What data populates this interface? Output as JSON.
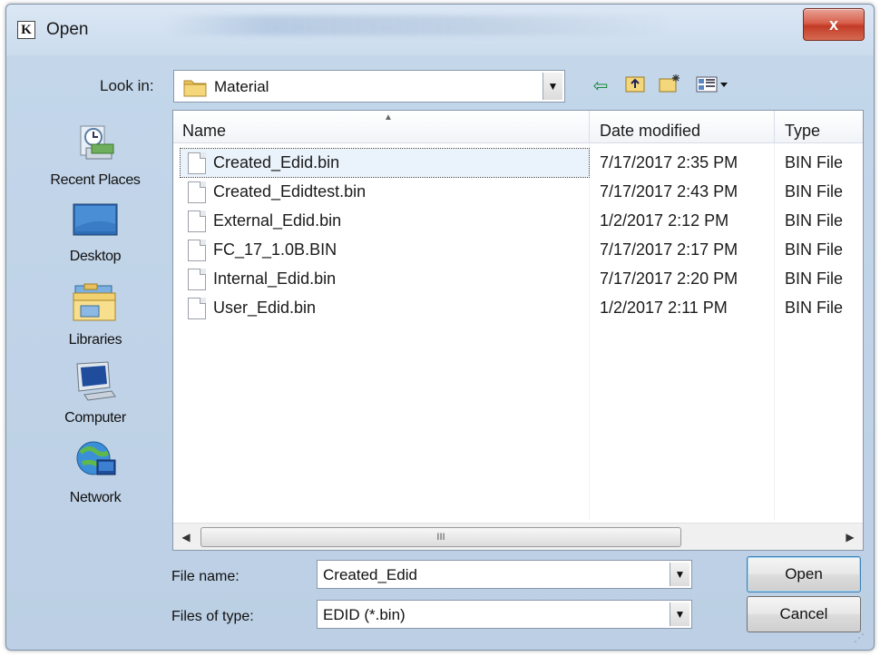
{
  "window": {
    "title": "Open",
    "app_icon_letter": "K",
    "close_symbol": "x"
  },
  "lookin": {
    "label": "Look in:",
    "value": "Material"
  },
  "toolbar": {
    "back_icon": "back-arrow-icon",
    "up_icon": "up-folder-icon",
    "new_folder_icon": "new-folder-icon",
    "view_icon": "view-menu-icon"
  },
  "places": [
    {
      "label": "Recent Places",
      "icon": "recent-places-icon"
    },
    {
      "label": "Desktop",
      "icon": "desktop-icon"
    },
    {
      "label": "Libraries",
      "icon": "libraries-icon"
    },
    {
      "label": "Computer",
      "icon": "computer-icon"
    },
    {
      "label": "Network",
      "icon": "network-icon"
    }
  ],
  "columns": {
    "name": "Name",
    "date": "Date modified",
    "type": "Type"
  },
  "files": [
    {
      "name": "Created_Edid.bin",
      "date": "7/17/2017 2:35 PM",
      "type": "BIN File",
      "selected": true
    },
    {
      "name": "Created_Edidtest.bin",
      "date": "7/17/2017 2:43 PM",
      "type": "BIN File"
    },
    {
      "name": "External_Edid.bin",
      "date": "1/2/2017 2:12 PM",
      "type": "BIN File"
    },
    {
      "name": "FC_17_1.0B.BIN",
      "date": "7/17/2017 2:17 PM",
      "type": "BIN File"
    },
    {
      "name": "Internal_Edid.bin",
      "date": "7/17/2017 2:20 PM",
      "type": "BIN File"
    },
    {
      "name": "User_Edid.bin",
      "date": "1/2/2017 2:11 PM",
      "type": "BIN File"
    }
  ],
  "scrollbar": {
    "grip": "III"
  },
  "filename": {
    "label": "File name:",
    "value": "Created_Edid"
  },
  "filetype": {
    "label": "Files of type:",
    "value": "EDID (*.bin)"
  },
  "buttons": {
    "open": "Open",
    "cancel": "Cancel"
  },
  "colors": {
    "title_bg": "#cbdcee",
    "close_red": "#c23b26",
    "selection": "#eaf2fb"
  }
}
